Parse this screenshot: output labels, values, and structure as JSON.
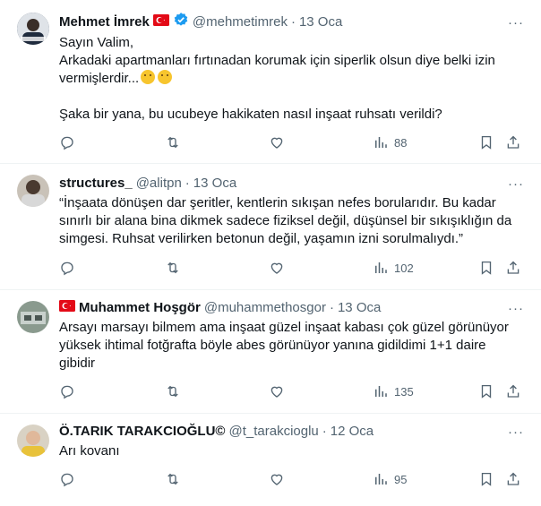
{
  "tweets": [
    {
      "name": "Mehmet İmrek",
      "handle": "@mehmetimrek",
      "date": "13 Oca",
      "body": "Sayın Valim,\nArkadaki apartmanları fırtınadan korumak için siperlik olsun diye belki izin\nvermişlerdir...",
      "body2": "Şaka bir yana, bu ucubeye hakikaten nasıl inşaat ruhsatı verildi?",
      "views": "88",
      "avatar_color": "#2f3f56"
    },
    {
      "name": "structures_",
      "handle": "@alitpn",
      "date": "13 Oca",
      "body": "“İnşaata dönüşen dar şeritler, kentlerin sıkışan nefes borularıdır. Bu kadar\nsınırlı bir alana bina dikmek sadece fiziksel değil, düşünsel bir sıkışıklığın da\nsimgesi. Ruhsat verilirken betonun değil, yaşamın izni sorulmalıydı.”",
      "views": "102",
      "avatar_color": "#7a6a5a"
    },
    {
      "name": "Muhammet Hoşgör",
      "handle": "@muhammethosgor",
      "date": "13 Oca",
      "body": "Arsayı marsayı bilmem ama inşaat güzel inşaat kabası çok güzel görünüyor\nyüksek ihtimal fotğrafta böyle abes görünüyor yanına gidildimi 1+1 daire\ngibidir",
      "views": "135",
      "avatar_color": "#5f6f6a"
    },
    {
      "name": "Ö.TARIK TARAKCIOĞLU©",
      "handle": "@t_tarakcioglu",
      "date": "12 Oca",
      "body": "Arı kovanı",
      "views": "95",
      "avatar_color": "#b8a890"
    }
  ],
  "dot": "·",
  "more": "···",
  "colors": {
    "icon": "#536471",
    "verified": "#1d9bf0",
    "flag": "#e30a17"
  }
}
